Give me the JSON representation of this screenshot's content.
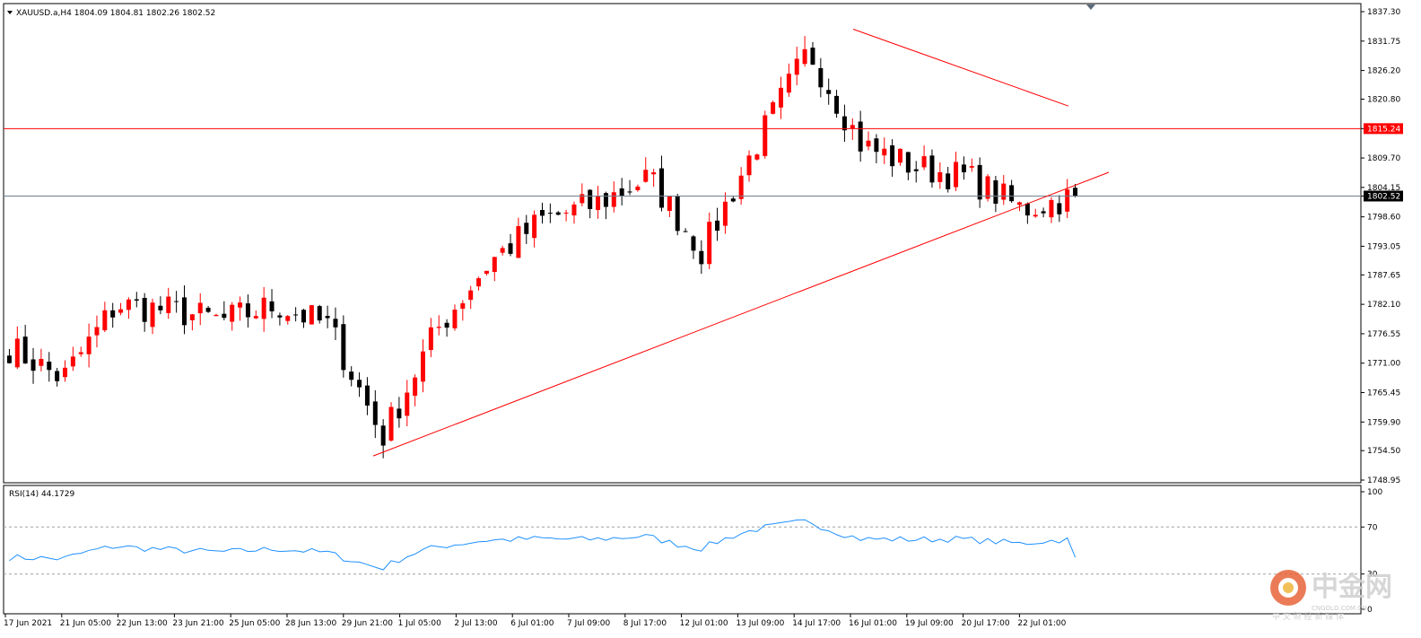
{
  "header": {
    "symbol_line": "XAUUSD.a,H4  1804.09 1804.81 1802.26 1802.52"
  },
  "price_axis": {
    "ticks": [
      "1837.30",
      "1831.75",
      "1826.20",
      "1820.80",
      "1815.24",
      "1809.70",
      "1804.15",
      "1802.52",
      "1798.60",
      "1793.05",
      "1787.65",
      "1782.10",
      "1776.55",
      "1771.00",
      "1765.45",
      "1759.90",
      "1754.50",
      "1748.95"
    ]
  },
  "time_axis": {
    "ticks": [
      "17 Jun 2021",
      "21 Jun 05:00",
      "22 Jun 13:00",
      "23 Jun 21:00",
      "25 Jun 05:00",
      "28 Jun 13:00",
      "29 Jun 21:00",
      "1 Jul 05:00",
      "2 Jul 13:00",
      "6 Jul 01:00",
      "7 Jul 09:00",
      "8 Jul 17:00",
      "12 Jul 01:00",
      "13 Jul 09:00",
      "14 Jul 17:00",
      "16 Jul 01:00",
      "19 Jul 09:00",
      "20 Jul 17:00",
      "22 Jul 01:00"
    ]
  },
  "rsi": {
    "label": "RSI(14) 44.1729",
    "levels": [
      "100",
      "70",
      "30",
      "0"
    ]
  },
  "watermark": {
    "title": "中金网",
    "url": "CNGOLD.COM.CN",
    "tagline": "中 文 财 经 新 媒 体"
  },
  "colors": {
    "bull": "#ff0000",
    "bear": "#000000",
    "rsi_line": "#1e90ff",
    "hline": "#ff0000",
    "trend": "#ff0000",
    "current_line": "#708090"
  },
  "chart_data": [
    {
      "type": "candlestick",
      "title": "XAUUSD.a,H4",
      "ohlc_last": {
        "open": 1804.09,
        "high": 1804.81,
        "low": 1802.26,
        "close": 1802.52
      },
      "ylim": [
        1748.95,
        1837.3
      ],
      "horizontal_line": 1815.24,
      "current_price": 1802.52,
      "x_tick_labels": [
        "17 Jun 2021",
        "21 Jun 05:00",
        "22 Jun 13:00",
        "23 Jun 21:00",
        "25 Jun 05:00",
        "28 Jun 13:00",
        "29 Jun 21:00",
        "1 Jul 05:00",
        "2 Jul 13:00",
        "6 Jul 01:00",
        "7 Jul 09:00",
        "8 Jul 17:00",
        "12 Jul 01:00",
        "13 Jul 09:00",
        "14 Jul 17:00",
        "16 Jul 01:00",
        "19 Jul 09:00",
        "20 Jul 17:00",
        "22 Jul 01:00"
      ],
      "close_path": [
        {
          "x": "17 Jun 2021",
          "close": 1774
        },
        {
          "x": "18 Jun",
          "close": 1768
        },
        {
          "x": "21 Jun 05:00",
          "close": 1782
        },
        {
          "x": "22 Jun 13:00",
          "close": 1781
        },
        {
          "x": "23 Jun 21:00",
          "close": 1779
        },
        {
          "x": "25 Jun 05:00",
          "close": 1782
        },
        {
          "x": "28 Jun 13:00",
          "close": 1778
        },
        {
          "x": "29 Jun 21:00",
          "close": 1757
        },
        {
          "x": "1 Jul 05:00",
          "close": 1777
        },
        {
          "x": "2 Jul 13:00",
          "close": 1790
        },
        {
          "x": "6 Jul 01:00",
          "close": 1798
        },
        {
          "x": "7 Jul 09:00",
          "close": 1801
        },
        {
          "x": "8 Jul 17:00",
          "close": 1806
        },
        {
          "x": "12 Jul 01:00",
          "close": 1792
        },
        {
          "x": "13 Jul 09:00",
          "close": 1812
        },
        {
          "x": "14 Jul 17:00",
          "close": 1830
        },
        {
          "x": "16 Jul 01:00",
          "close": 1812
        },
        {
          "x": "19 Jul 09:00",
          "close": 1808
        },
        {
          "x": "20 Jul 17:00",
          "close": 1806
        },
        {
          "x": "22 Jul 01:00",
          "close": 1800
        },
        {
          "x": "last",
          "close": 1802.52
        }
      ],
      "trendlines": [
        {
          "name": "support",
          "from": {
            "x": "29 Jun 21:00",
            "y": 1753.5
          },
          "to": {
            "x": "22 Jul 01:00",
            "y": 1807
          }
        },
        {
          "name": "resistance",
          "from": {
            "x": "14 Jul 17:00",
            "y": 1834
          },
          "to": {
            "x": "20 Jul 17:00",
            "y": 1819.5
          }
        }
      ]
    },
    {
      "type": "line",
      "title": "RSI(14) 44.1729",
      "ylim": [
        0,
        100
      ],
      "levels": [
        70,
        30
      ],
      "last_value": 44.1729
    }
  ]
}
